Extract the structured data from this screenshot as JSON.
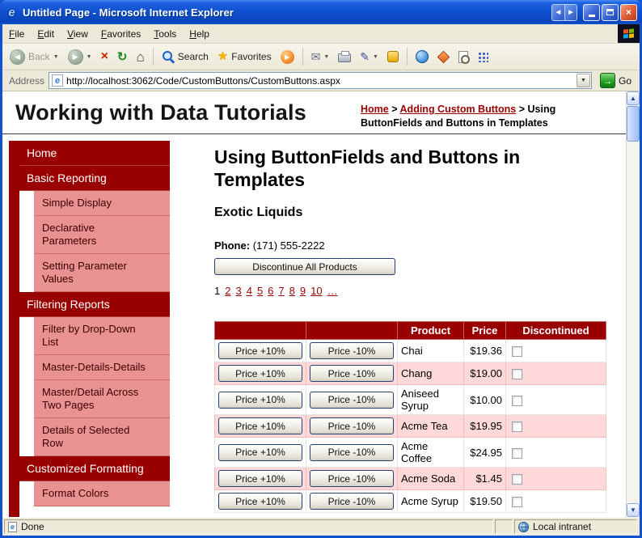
{
  "window": {
    "title": "Untitled Page - Microsoft Internet Explorer"
  },
  "menu": {
    "items": [
      "File",
      "Edit",
      "View",
      "Favorites",
      "Tools",
      "Help"
    ]
  },
  "toolbar": {
    "back_label": "Back",
    "search_label": "Search",
    "favorites_label": "Favorites"
  },
  "address": {
    "label": "Address",
    "url": "http://localhost:3062/Code/CustomButtons/CustomButtons.aspx",
    "go_label": "Go"
  },
  "header": {
    "site_title": "Working with Data Tutorials",
    "separator": ">",
    "breadcrumb": [
      {
        "label": "Home",
        "link": true
      },
      {
        "label": "Adding Custom Buttons",
        "link": true
      },
      {
        "label": "Using ButtonFields and Buttons in Templates",
        "link": false
      }
    ]
  },
  "sidebar": {
    "items": [
      {
        "label": "Home",
        "level": "section"
      },
      {
        "label": "Basic Reporting",
        "level": "section"
      },
      {
        "label": "Simple Display",
        "level": "item"
      },
      {
        "label": "Declarative Parameters",
        "level": "item"
      },
      {
        "label": "Setting Parameter Values",
        "level": "item"
      },
      {
        "label": "Filtering Reports",
        "level": "section"
      },
      {
        "label": "Filter by Drop-Down List",
        "level": "item"
      },
      {
        "label": "Master-Details-Details",
        "level": "item"
      },
      {
        "label": "Master/Detail Across Two Pages",
        "level": "item"
      },
      {
        "label": "Details of Selected Row",
        "level": "item"
      },
      {
        "label": "Customized Formatting",
        "level": "section"
      },
      {
        "label": "Format Colors",
        "level": "item"
      }
    ]
  },
  "content": {
    "title": "Using ButtonFields and Buttons in Templates",
    "supplier": "Exotic Liquids",
    "phone_label": "Phone:",
    "phone_value": "(171) 555-2222",
    "discontinue_all_label": "Discontinue All Products",
    "pager": {
      "current": "1",
      "pages": [
        "2",
        "3",
        "4",
        "5",
        "6",
        "7",
        "8",
        "9",
        "10",
        "…"
      ]
    },
    "grid": {
      "headers": [
        "",
        "",
        "Product",
        "Price",
        "Discontinued"
      ],
      "price_up_label": "Price +10%",
      "price_down_label": "Price -10%",
      "rows": [
        {
          "product": "Chai",
          "price": "$19.36",
          "discontinued": false
        },
        {
          "product": "Chang",
          "price": "$19.00",
          "discontinued": false
        },
        {
          "product": "Aniseed Syrup",
          "price": "$10.00",
          "discontinued": false
        },
        {
          "product": "Acme Tea",
          "price": "$19.95",
          "discontinued": false
        },
        {
          "product": "Acme Coffee",
          "price": "$24.95",
          "discontinued": false
        },
        {
          "product": "Acme Soda",
          "price": "$1.45",
          "discontinued": false
        },
        {
          "product": "Acme Syrup",
          "price": "$19.50",
          "discontinued": false
        }
      ]
    }
  },
  "status": {
    "text": "Done",
    "zone": "Local intranet"
  },
  "icons": {
    "ie_e": "e",
    "back_arrow": "◀",
    "forward_arrow": "▶",
    "close": "×",
    "stop": "×",
    "refresh": "↻",
    "home": "⌂",
    "star": "★",
    "play": "▶",
    "mail": "✉",
    "pencil": "✎",
    "caret": "▼",
    "up_arrow": "▲",
    "down_arrow": "▼",
    "go_arrow": "→"
  },
  "colors": {
    "maroon": "#990000",
    "sidebar_pink": "#e89292",
    "row_pink": "#ffd9d9",
    "chrome": "#ece9d8",
    "titlebar_blue": "#0f52d2"
  }
}
